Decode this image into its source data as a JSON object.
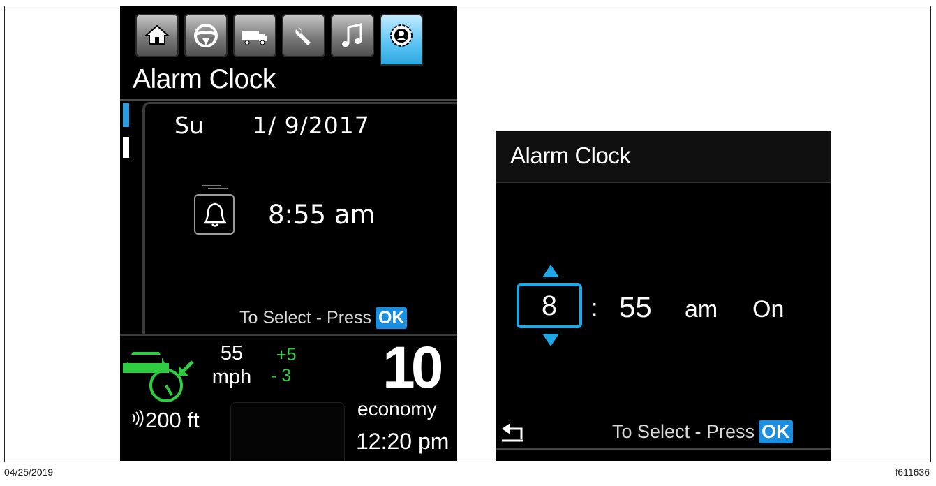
{
  "left_screen": {
    "tabs": [
      {
        "icon": "home-icon",
        "active": false
      },
      {
        "icon": "steering-wheel-icon",
        "active": false
      },
      {
        "icon": "truck-icon",
        "active": false
      },
      {
        "icon": "wrench-icon",
        "active": false
      },
      {
        "icon": "music-note-icon",
        "active": false
      },
      {
        "icon": "settings-gear-icon",
        "active": true
      }
    ],
    "title": "Alarm Clock",
    "day": "Su",
    "date": "1/ 9/2017",
    "alarm_time": "8:55 am",
    "select_prompt": "To Select - Press",
    "ok_label": "OK",
    "speed": "55",
    "speed_unit": "mph",
    "speed_plus": "+5",
    "speed_minus": "- 3",
    "score": "10",
    "score_label": "economy",
    "distance": "200 ft",
    "clock": "12:20 pm"
  },
  "right_screen": {
    "title": "Alarm Clock",
    "hour": "8",
    "colon": ":",
    "minute": "55",
    "ampm": "am",
    "status": "On",
    "select_prompt": "To Select - Press",
    "ok_label": "OK"
  },
  "footer": {
    "date": "04/25/2019",
    "figure_id": "f611636"
  },
  "colors": {
    "accent_blue": "#1fa7e6",
    "positive_green": "#2ecc40",
    "background": "#000000"
  }
}
